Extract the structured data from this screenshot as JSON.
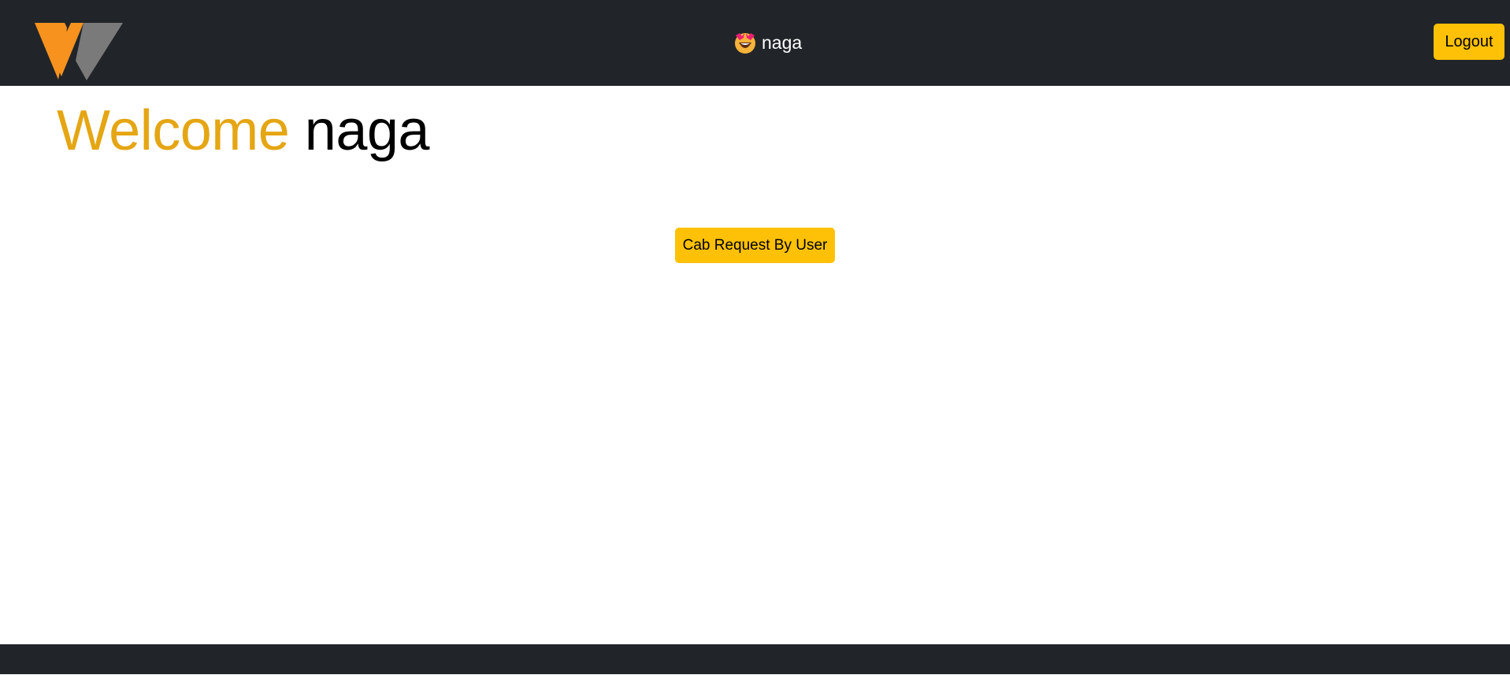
{
  "header": {
    "logo_icon": "brand-logo-icon",
    "user": {
      "emoji_icon": "star-struck-emoji-icon",
      "username": "naga"
    },
    "logout_label": "Logout"
  },
  "main": {
    "welcome_word": "Welcome",
    "welcome_name": "naga",
    "cab_request_label": "Cab Request By User"
  },
  "colors": {
    "navbar_bg": "#212529",
    "accent": "#ffc107",
    "welcome_accent": "#e5a614",
    "logo_orange": "#f7921e",
    "logo_gray": "#7a7a7a"
  }
}
